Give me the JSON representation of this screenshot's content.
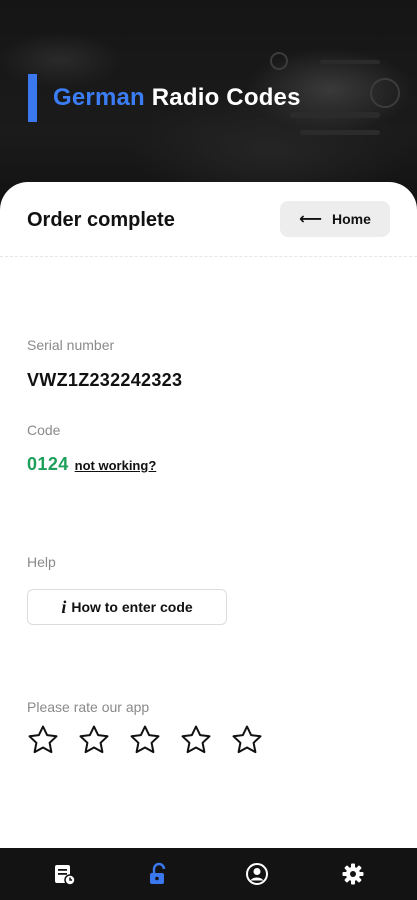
{
  "header": {
    "brand_accent": "German",
    "brand_rest": " Radio Codes",
    "accent_color": "#3b78f0"
  },
  "sheet": {
    "title": "Order complete",
    "home_button": {
      "icon": "arrow-left-icon",
      "label": "Home"
    }
  },
  "order": {
    "serial_label": "Serial number",
    "serial_value": "VWZ1Z232242323",
    "code_label": "Code",
    "code_value": "0124",
    "code_color": "#1ea05b",
    "not_working_label": "not working?"
  },
  "help": {
    "label": "Help",
    "button_label": "How to enter code",
    "button_icon": "info-icon"
  },
  "rating": {
    "label": "Please rate our app",
    "max_stars": 5,
    "current_rating": 0
  },
  "bottom_nav": {
    "items": [
      {
        "icon": "orders-icon",
        "active": false
      },
      {
        "icon": "unlock-icon",
        "active": true
      },
      {
        "icon": "account-icon",
        "active": false
      },
      {
        "icon": "settings-icon",
        "active": false
      }
    ],
    "active_color": "#3b78f0"
  }
}
